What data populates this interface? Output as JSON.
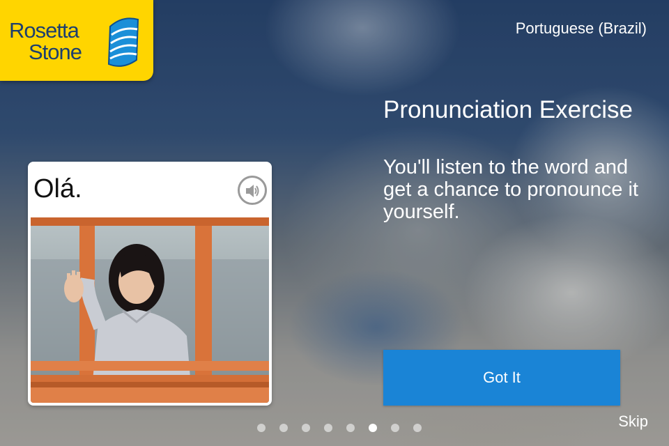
{
  "brand": {
    "line1": "Rosetta",
    "line2": "Stone",
    "logo_icon": "rosetta-stone-logo-icon",
    "colors": {
      "badge": "#ffd500",
      "text": "#1d3f6e"
    }
  },
  "language": "Portuguese (Brazil)",
  "exercise": {
    "title": "Pronunciation Exercise",
    "description": "You'll listen to the word and get a chance to pronounce it yourself."
  },
  "card": {
    "word": "Olá.",
    "audio_icon": "speaker-icon",
    "image_subject": "woman-waving-photo"
  },
  "actions": {
    "got_it_label": "Got It",
    "skip_label": "Skip",
    "accent": "#1a84d6"
  },
  "pagination": {
    "total": 8,
    "active_index": 5
  }
}
